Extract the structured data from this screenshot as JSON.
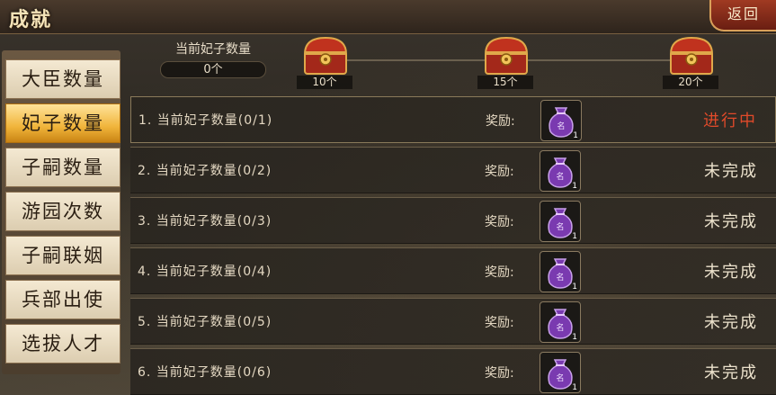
{
  "header": {
    "title": "成就",
    "back_label": "返回"
  },
  "sidebar": {
    "items": [
      {
        "label": "大臣数量",
        "active": false
      },
      {
        "label": "妃子数量",
        "active": true
      },
      {
        "label": "子嗣数量",
        "active": false
      },
      {
        "label": "游园次数",
        "active": false
      },
      {
        "label": "子嗣联姻",
        "active": false
      },
      {
        "label": "兵部出使",
        "active": false
      },
      {
        "label": "选拔人才",
        "active": false
      }
    ]
  },
  "progress": {
    "current_label": "当前妃子数量",
    "current_value": "0个",
    "milestones": [
      {
        "label": "10个"
      },
      {
        "label": "15个"
      },
      {
        "label": "20个"
      }
    ]
  },
  "tasks": {
    "reward_label": "奖励:",
    "rows": [
      {
        "text": "1. 当前妃子数量(0/1)",
        "reward_count": "1",
        "status": "进行中"
      },
      {
        "text": "2. 当前妃子数量(0/2)",
        "reward_count": "1",
        "status": "未完成"
      },
      {
        "text": "3. 当前妃子数量(0/3)",
        "reward_count": "1",
        "status": "未完成"
      },
      {
        "text": "4. 当前妃子数量(0/4)",
        "reward_count": "1",
        "status": "未完成"
      },
      {
        "text": "5. 当前妃子数量(0/5)",
        "reward_count": "1",
        "status": "未完成"
      },
      {
        "text": "6. 当前妃子数量(0/6)",
        "reward_count": "1",
        "status": "未完成"
      }
    ]
  },
  "colors": {
    "active_status": "#e04a2a",
    "active_tab": "#f0b43a",
    "reward_bag": "#7a3ab0"
  },
  "icons": {
    "chest": "treasure-chest-icon",
    "reward": "purple-bag-icon"
  }
}
